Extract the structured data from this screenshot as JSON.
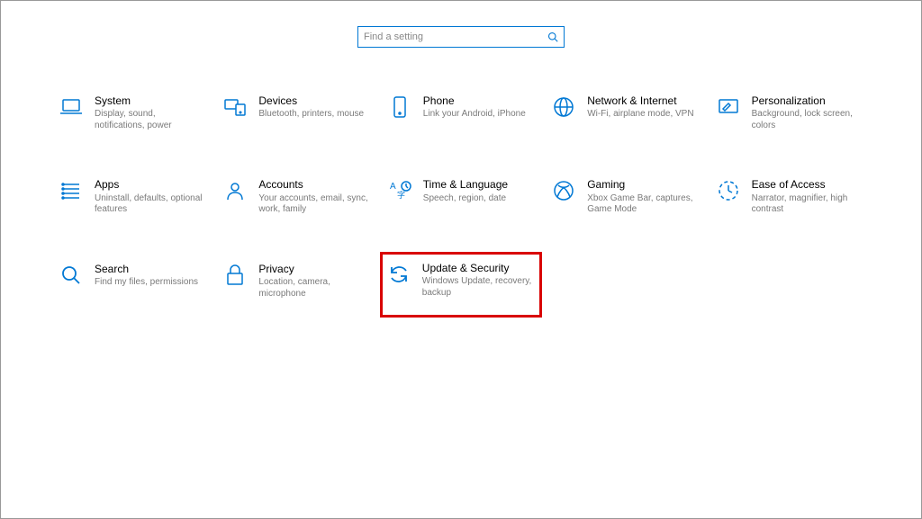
{
  "search": {
    "placeholder": "Find a setting"
  },
  "tiles": {
    "system": {
      "title": "System",
      "desc": "Display, sound, notifications, power"
    },
    "devices": {
      "title": "Devices",
      "desc": "Bluetooth, printers, mouse"
    },
    "phone": {
      "title": "Phone",
      "desc": "Link your Android, iPhone"
    },
    "network": {
      "title": "Network & Internet",
      "desc": "Wi-Fi, airplane mode, VPN"
    },
    "personalization": {
      "title": "Personalization",
      "desc": "Background, lock screen, colors"
    },
    "apps": {
      "title": "Apps",
      "desc": "Uninstall, defaults, optional features"
    },
    "accounts": {
      "title": "Accounts",
      "desc": "Your accounts, email, sync, work, family"
    },
    "time": {
      "title": "Time & Language",
      "desc": "Speech, region, date"
    },
    "gaming": {
      "title": "Gaming",
      "desc": "Xbox Game Bar, captures, Game Mode"
    },
    "ease": {
      "title": "Ease of Access",
      "desc": "Narrator, magnifier, high contrast"
    },
    "search_tile": {
      "title": "Search",
      "desc": "Find my files, permissions"
    },
    "privacy": {
      "title": "Privacy",
      "desc": "Location, camera, microphone"
    },
    "update": {
      "title": "Update & Security",
      "desc": "Windows Update, recovery, backup"
    }
  }
}
